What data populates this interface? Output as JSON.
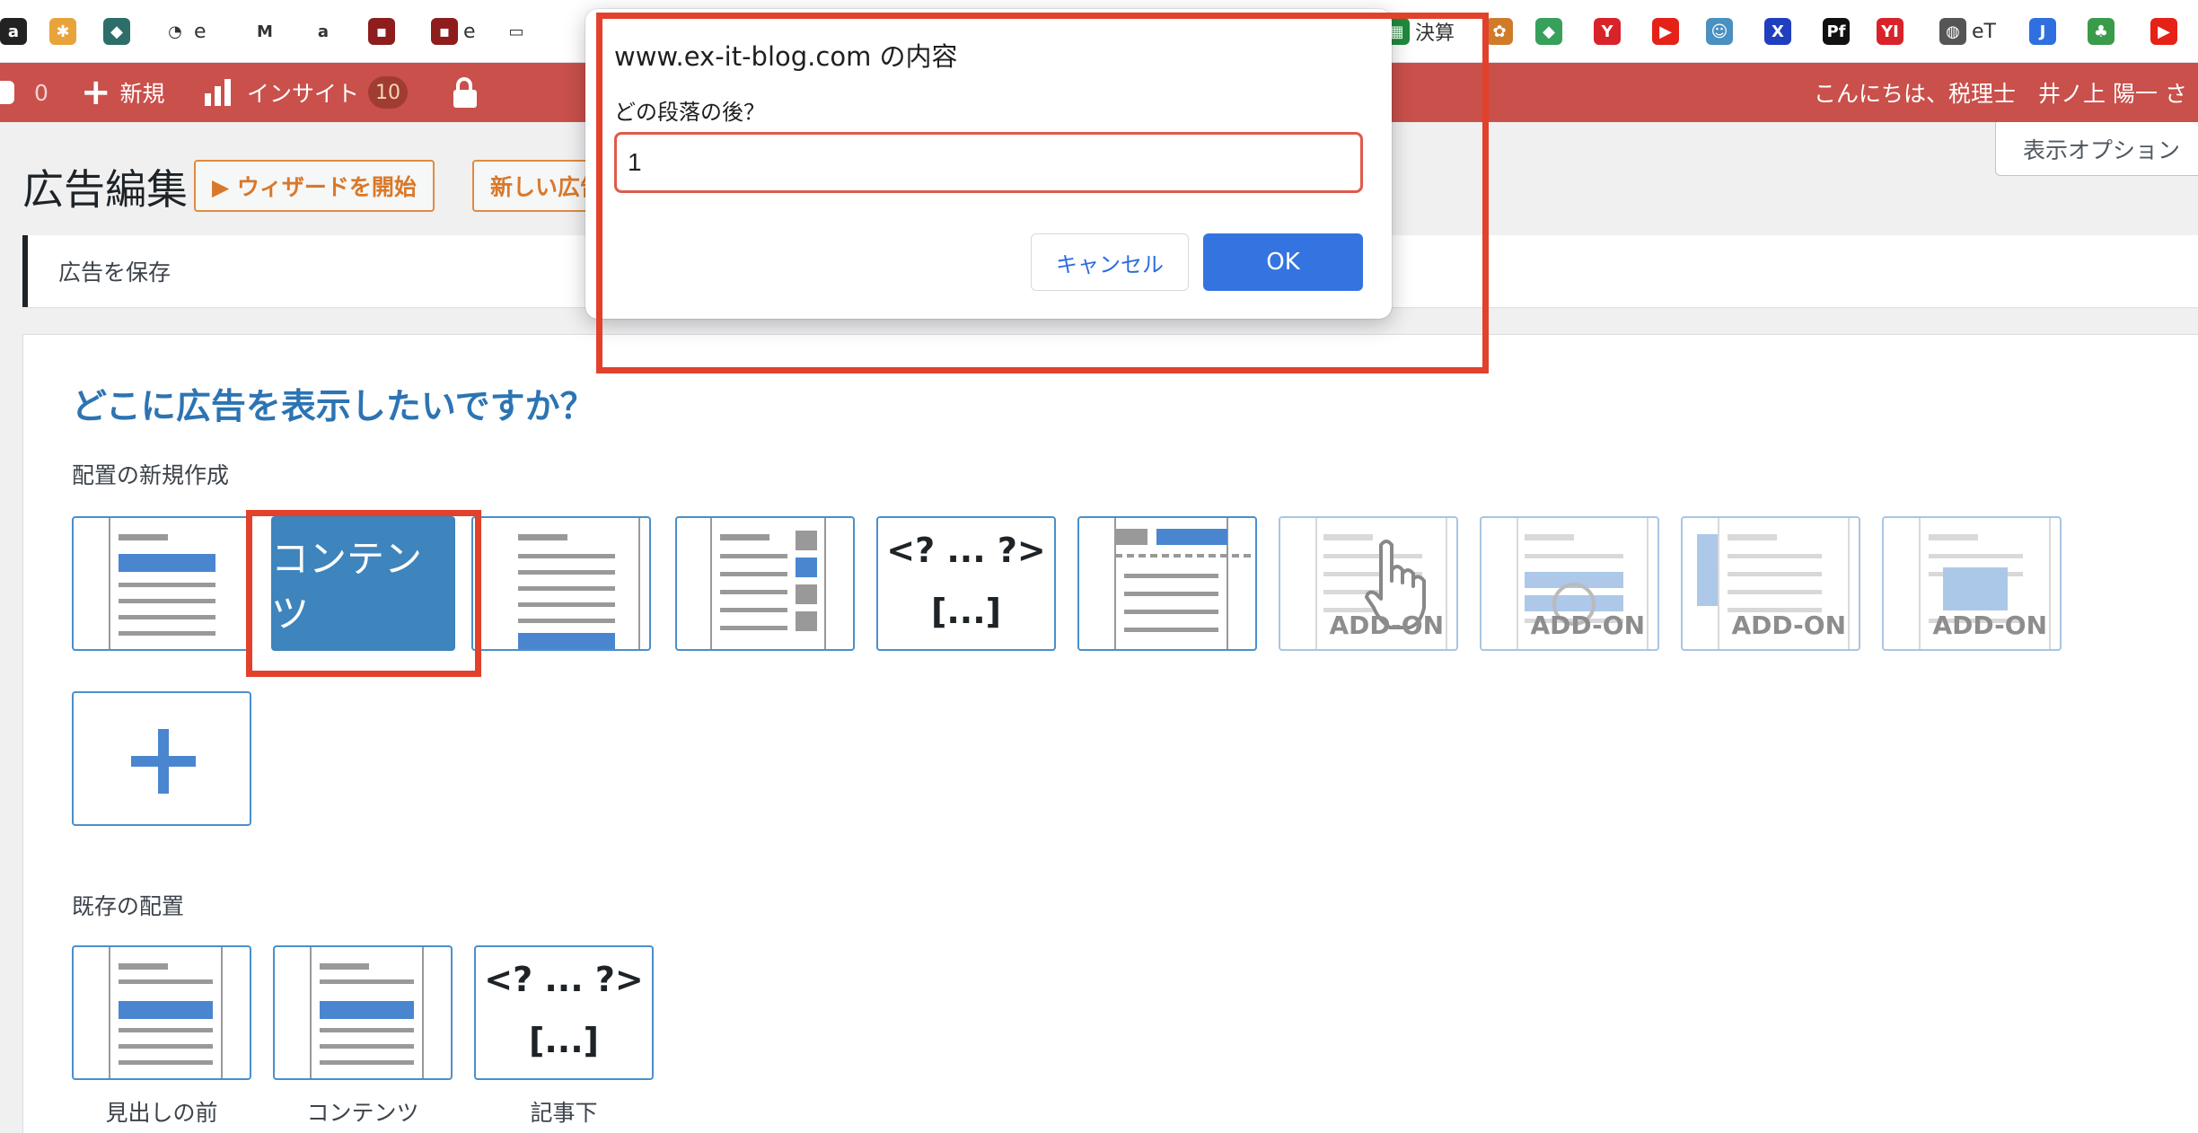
{
  "bookmarks": [
    {
      "icon": "amazon-icon",
      "glyph": "a",
      "color": "#222222",
      "text": ""
    },
    {
      "icon": "pinwheel-icon",
      "glyph": "✱",
      "color": "#e8a33b",
      "text": ""
    },
    {
      "icon": "bird-icon",
      "glyph": "◆",
      "color": "#2d6d6a",
      "text": ""
    },
    {
      "icon": "clock-icon",
      "glyph": "◔",
      "color": "#ffffff",
      "text": "e"
    },
    {
      "icon": "gmail-icon",
      "glyph": "M",
      "color": "#ffffff",
      "text": ""
    },
    {
      "icon": "amazon-icon",
      "glyph": "a",
      "color": "#ffffff",
      "text": ""
    },
    {
      "icon": "book-icon",
      "glyph": "▪",
      "color": "#8e1d1d",
      "text": ""
    },
    {
      "icon": "book-icon",
      "glyph": "▪",
      "color": "#8e1d1d",
      "text": "e"
    },
    {
      "icon": "laptop-icon",
      "glyph": "▭",
      "color": "#ffffff",
      "text": ""
    },
    {
      "icon": "spreadsheet-icon",
      "glyph": "▦",
      "color": "#1f8a3c",
      "text": "決算"
    },
    {
      "icon": "game-icon",
      "glyph": "✿",
      "color": "#d07b2a",
      "text": ""
    },
    {
      "icon": "feedly-icon",
      "glyph": "◆",
      "color": "#37a05b",
      "text": ""
    },
    {
      "icon": "y-icon",
      "glyph": "Y",
      "color": "#d8232a",
      "text": ""
    },
    {
      "icon": "youtube-icon",
      "glyph": "▶",
      "color": "#e62117",
      "text": ""
    },
    {
      "icon": "face-icon",
      "glyph": "☺",
      "color": "#4a90c0",
      "text": ""
    },
    {
      "icon": "x-icon",
      "glyph": "X",
      "color": "#1f3fbf",
      "text": ""
    },
    {
      "icon": "pf-icon",
      "glyph": "Pf",
      "color": "#111111",
      "text": ""
    },
    {
      "icon": "yi-icon",
      "glyph": "YI",
      "color": "#d8232a",
      "text": ""
    },
    {
      "icon": "globe-icon",
      "glyph": "◍",
      "color": "#555555",
      "text": "eT"
    },
    {
      "icon": "j-icon",
      "glyph": "J",
      "color": "#2f6fe0",
      "text": ""
    },
    {
      "icon": "plant-icon",
      "glyph": "♣",
      "color": "#3a9b4a",
      "text": ""
    },
    {
      "icon": "youtube-icon",
      "glyph": "▶",
      "color": "#e62117",
      "text": ""
    }
  ],
  "adminbar": {
    "comments_count": "0",
    "new_label": "新規",
    "insight_label": "インサイト",
    "insight_badge": "10",
    "greeting": "こんにちは、税理士　井ノ上 陽一 さ"
  },
  "screen_options": "表示オプション",
  "page": {
    "title": "広告編集",
    "wizard_button": "▶ ウィザードを開始",
    "new_ad_button": "新しい広告",
    "save_label": "広告を保存",
    "question": "どこに広告を表示したいですか？",
    "new_placement_label": "配置の新規作成",
    "existing_placement_label": "既存の配置"
  },
  "placements": {
    "selected_label": "コンテンツ",
    "code_top": "<? ... ?>",
    "code_bottom": "[...]",
    "addon_label": "ADD-ON"
  },
  "existing": [
    {
      "caption": "見出しの前"
    },
    {
      "caption": "コンテンツ"
    },
    {
      "caption": "記事下"
    }
  ],
  "dialog": {
    "title": "www.ex-it-blog.com の内容",
    "message": "どの段落の後？",
    "input_value": "1",
    "cancel": "キャンセル",
    "ok": "OK"
  },
  "colors": {
    "accent": "#3e84bd",
    "adminbar": "#c9504b",
    "highlight_frame": "#e2412c",
    "ok_button": "#3474e0"
  }
}
